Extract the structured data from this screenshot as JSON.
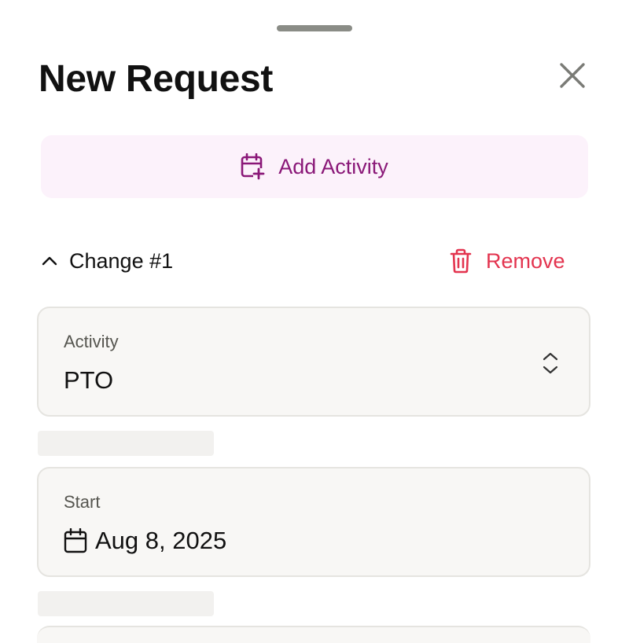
{
  "sheet": {
    "title": "New Request"
  },
  "add_activity": {
    "label": "Add Activity",
    "icon": "calendar-plus-icon",
    "color": "#8a1878",
    "background": "#fcf2fb"
  },
  "change": {
    "label": "Change #1",
    "expanded": true,
    "remove_label": "Remove",
    "remove_color": "#e3344f"
  },
  "fields": {
    "activity": {
      "label": "Activity",
      "value": "PTO"
    },
    "start": {
      "label": "Start",
      "value": "Aug 8, 2025"
    }
  }
}
